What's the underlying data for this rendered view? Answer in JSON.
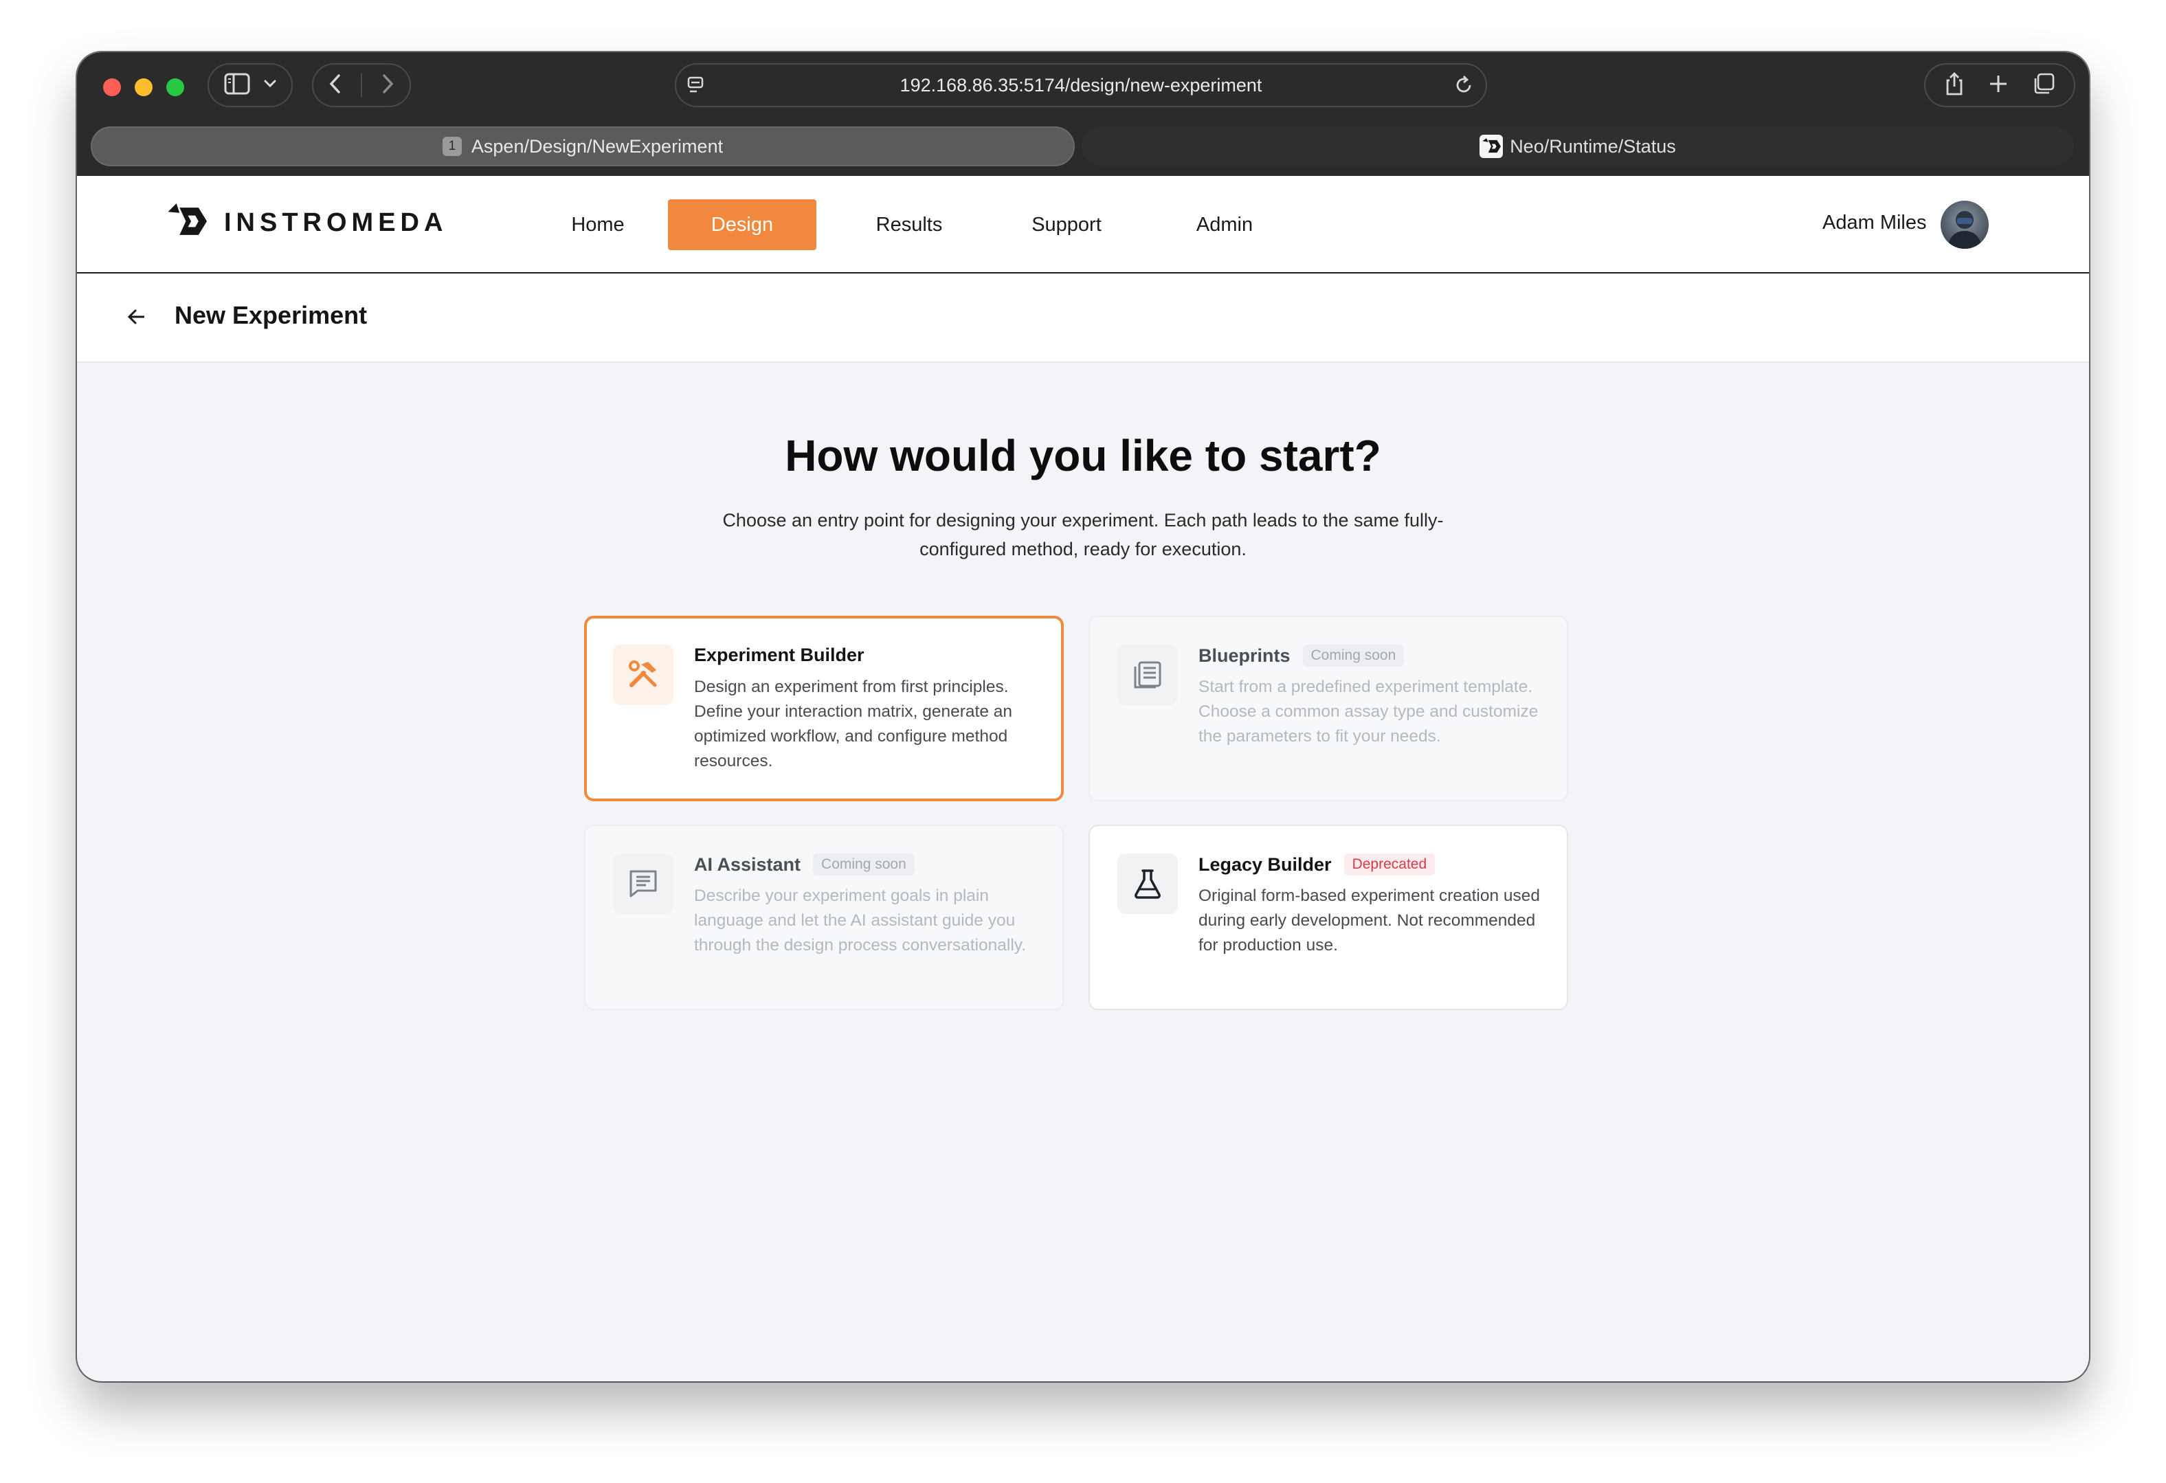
{
  "browser": {
    "url": "192.168.86.35:5174/design/new-experiment",
    "tabs": [
      {
        "badge": "1",
        "label": "Aspen/Design/NewExperiment",
        "active": true
      },
      {
        "label": "Neo/Runtime/Status",
        "active": false
      }
    ]
  },
  "app": {
    "brand": "INSTROMEDA",
    "nav": {
      "home": "Home",
      "design": "Design",
      "results": "Results",
      "support": "Support",
      "admin": "Admin"
    },
    "active_nav": "Design",
    "user_name": "Adam Miles"
  },
  "page": {
    "title": "New Experiment",
    "heading": "How would you like to start?",
    "subheading": "Choose an entry point for designing your experiment. Each path leads to the same fully-configured method, ready for execution."
  },
  "cards": {
    "builder": {
      "title": "Experiment Builder",
      "description": "Design an experiment from first principles. Define your interaction matrix, generate an optimized workflow, and configure method resources.",
      "icon": "tools-icon"
    },
    "blueprints": {
      "title": "Blueprints",
      "badge": "Coming soon",
      "description": "Start from a predefined experiment template. Choose a common assay type and customize the parameters to fit your needs.",
      "icon": "document-list-icon"
    },
    "assistant": {
      "title": "AI Assistant",
      "badge": "Coming soon",
      "description": "Describe your experiment goals in plain language and let the AI assistant guide you through the design process conversationally.",
      "icon": "chat-icon"
    },
    "legacy": {
      "title": "Legacy Builder",
      "badge": "Deprecated",
      "description": "Original form-based experiment creation used during early development. Not recommended for production use.",
      "icon": "flask-icon"
    }
  },
  "colors": {
    "accent": "#f0893d",
    "deprecated": "#d93a4a",
    "page_background": "#f3f4f7"
  }
}
